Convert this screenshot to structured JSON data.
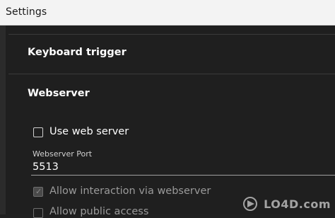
{
  "window": {
    "title": "Settings"
  },
  "sections": {
    "keyboard_trigger": "Keyboard trigger",
    "webserver": "Webserver"
  },
  "webserver": {
    "use_web_server": {
      "label": "Use web server",
      "checked": false
    },
    "port": {
      "label": "Webserver Port",
      "value": "5513"
    },
    "allow_interaction": {
      "label": "Allow interaction via webserver",
      "checked": true,
      "disabled": true
    },
    "allow_public_access": {
      "label": "Allow public access",
      "checked": false,
      "disabled": true
    }
  },
  "watermark": {
    "text": "LO4D.com"
  },
  "colors": {
    "background": "#1f1f1f",
    "titlebar": "#f3f3f3",
    "text": "#ffffff",
    "disabled_text": "#9a9a9a"
  }
}
